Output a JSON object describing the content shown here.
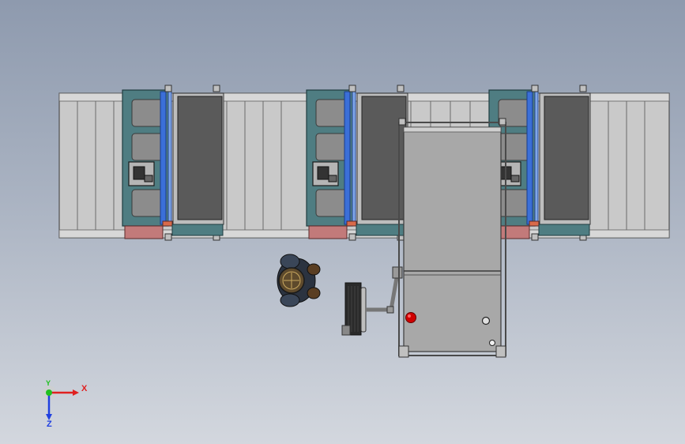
{
  "view": {
    "type": "cad-top-view",
    "background_colors": [
      "#8e9aae",
      "#d3d7de"
    ]
  },
  "conveyor": {
    "roller_color": "#c9c9c9",
    "outline_color": "#505050",
    "stations": 3
  },
  "cabinet": {
    "body_color": "#a8a8a8",
    "frame_color": "#4a4a4a"
  },
  "operator": {
    "icon": "worker-top-view-icon"
  },
  "keyboard": {
    "icon": "keyboard-arm-icon"
  },
  "estop": {
    "color": "#d00000"
  },
  "triad": {
    "x_label": "X",
    "y_label": "Y",
    "z_label": "Z",
    "x_color": "#e02020",
    "y_color": "#20c020",
    "z_color": "#2040e0"
  }
}
